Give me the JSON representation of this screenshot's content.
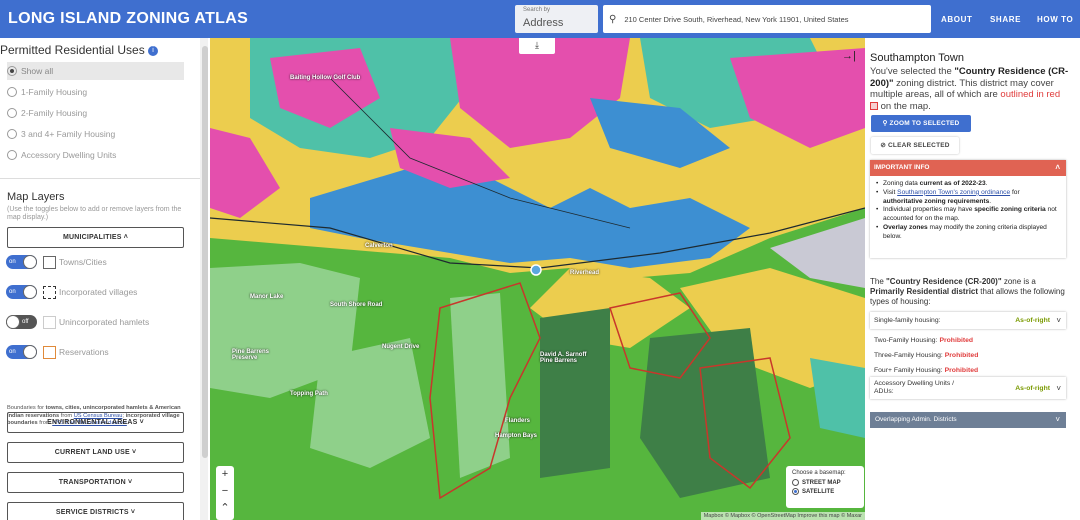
{
  "header": {
    "title": "LONG ISLAND ZONING ATLAS",
    "search_by_label": "Search by",
    "search_by_value": "Address",
    "search_value": "210 Center Drive South, Riverhead, New York 11901, United States",
    "nav": [
      "ABOUT",
      "SHARE",
      "HOW TO"
    ],
    "accent": "#3f6fcf"
  },
  "left": {
    "uses_title": "Permitted Residential Uses",
    "uses": [
      "Show all",
      "1-Family Housing",
      "2-Family Housing",
      "3 and 4+ Family Housing",
      "Accessory Dwelling Units"
    ],
    "layers_title": "Map Layers",
    "layers_sub": "(Use the toggles below to add or remove layers from the map display.)",
    "municipalities_btn": "MUNICIPALITIES ˄",
    "toggles": [
      {
        "state": "on",
        "label": "Towns/Cities"
      },
      {
        "state": "on",
        "label": "Incorporated villages"
      },
      {
        "state": "off",
        "label": "Unincorporated hamlets"
      },
      {
        "state": "on",
        "label": "Reservations"
      }
    ],
    "boundaries_note_1": "Boundaries for ",
    "boundaries_note_bold": "towns, cities, unincorporated hamlets & American Indian reservations",
    "boundaries_note_2": " from ",
    "boundaries_link_1": "US Census Bureau",
    "boundaries_note_3": "; ",
    "boundaries_note_bold2": "incorporated village boundaries",
    "boundaries_note_4": " from ",
    "boundaries_link_2": "NYS Civil Boundaries dataset",
    "boundaries_note_5": ".",
    "sections": [
      "ENVIRONMENTAL AREAS ˅",
      "CURRENT LAND USE ˅",
      "TRANSPORTATION ˅",
      "SERVICE DISTRICTS ˅"
    ]
  },
  "map": {
    "place_labels": [
      "Baiting Hollow Golf Club",
      "Calverton",
      "Riverhead",
      "South Shore Road",
      "Manor Lake",
      "Nugent Drive",
      "Pine Barrens Preserve",
      "David A. Sarnoff Pine Barrens",
      "Topping Path",
      "Flanders",
      "Hampton Bays"
    ],
    "basemap_title": "Choose a basemap:",
    "basemap_options": [
      "STREET MAP",
      "SATELLITE"
    ],
    "basemap_selected": "SATELLITE",
    "attribution": "Mapbox © Mapbox © OpenStreetMap Improve this map © Maxar",
    "zoom_in": "+",
    "zoom_out": "−",
    "reset": "⌃",
    "download_icon": "⤓",
    "collapse_icon": "→|",
    "zone_colors": {
      "residential_a": "#e44fad",
      "residential_b": "#eccd4e",
      "residential_c": "#4fc1a8",
      "commercial": "#3d8fd2",
      "open_space": "#56b63e",
      "light_green": "#8fd08a",
      "dark_preserve": "#3e7f47"
    }
  },
  "right": {
    "title": "Southampton Town",
    "desc_1": "You've selected the ",
    "desc_zone": "\"Country Residence (CR-200)\"",
    "desc_2": " zoning district. This district may cover multiple areas, all of which are ",
    "desc_red": "outlined in red",
    "desc_3": " on the map.",
    "zoom_btn": "ZOOM TO SELECTED",
    "clear_btn": "CLEAR SELECTED",
    "info_header": "IMPORTANT INFO",
    "info_items": [
      {
        "a": "Zoning data ",
        "b": "current as of 2022-23",
        "c": "."
      },
      {
        "a": "Visit ",
        "link": "Southampton Town's zoning ordinance",
        "c": " for ",
        "b": "authoritative zoning requirements",
        "d": "."
      },
      {
        "a": "Individual properties may have ",
        "b": "specific zoning criteria",
        "c": " not accounted for on the map."
      },
      {
        "b": "Overlay zones",
        "c": " may modify the zoning criteria displayed below."
      }
    ],
    "zone_text_1": "The ",
    "zone_text_name": "\"Country Residence (CR-200)\"",
    "zone_text_2": " zone is a ",
    "zone_text_type": "Primarily Residential district",
    "zone_text_3": " that allows the following types of housing:",
    "housing": [
      {
        "label": "Single-family housing:",
        "status": "As-of-right",
        "card": true
      },
      {
        "label": "Two-Family Housing:",
        "status": "Prohibited",
        "card": false
      },
      {
        "label": "Three-Family Housing:",
        "status": "Prohibited",
        "card": false
      },
      {
        "label": "Four+ Family Housing:",
        "status": "Prohibited",
        "card": false
      },
      {
        "label": "Accessory Dwelling Units / ADUs:",
        "status": "As-of-right",
        "card": true
      }
    ],
    "overlap_label": "Overlapping Admin. Districts",
    "info_color": "#e06353"
  }
}
